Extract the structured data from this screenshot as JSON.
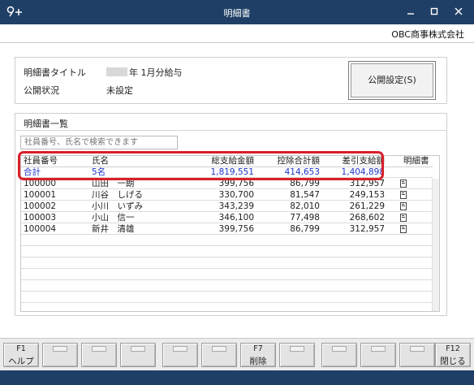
{
  "window": {
    "title": "明細書",
    "icons": {
      "app": "key-plus-icon",
      "minimize": "minimize-icon",
      "maximize": "maximize-icon",
      "close": "close-icon"
    }
  },
  "header": {
    "company": "OBC商事株式会社"
  },
  "info": {
    "title_label": "明細書タイトル",
    "title_value": "年 1月分給与",
    "status_label": "公開状況",
    "status_value": "未設定",
    "publish_button": "公開設定(S)"
  },
  "list": {
    "title": "明細書一覧",
    "search_placeholder": "社員番号、氏名で検索できます",
    "columns": {
      "emp_no": "社員番号",
      "name": "氏名",
      "gross": "総支給金額",
      "deduction": "控除合計額",
      "net": "差引支給額",
      "doc": "明細書"
    },
    "total": {
      "label": "合計",
      "count": "5名",
      "gross": "1,819,551",
      "deduction": "414,653",
      "net": "1,404,898"
    },
    "rows": [
      {
        "emp_no": "100000",
        "name": "山田　一朗",
        "gross": "399,756",
        "deduction": "86,799",
        "net": "312,957"
      },
      {
        "emp_no": "100001",
        "name": "川谷　しげる",
        "gross": "330,700",
        "deduction": "81,547",
        "net": "249,153"
      },
      {
        "emp_no": "100002",
        "name": "小川　いずみ",
        "gross": "343,239",
        "deduction": "82,010",
        "net": "261,229"
      },
      {
        "emp_no": "100003",
        "name": "小山　信一",
        "gross": "346,100",
        "deduction": "77,498",
        "net": "268,602"
      },
      {
        "emp_no": "100004",
        "name": "新井　清雄",
        "gross": "399,756",
        "deduction": "86,799",
        "net": "312,957"
      }
    ],
    "doc_icon": "document-icon"
  },
  "footer": {
    "f1_num": "F1",
    "f1_label": "ヘルプ",
    "f7_num": "F7",
    "f7_label": "削除",
    "f12_num": "F12",
    "f12_label": "閉じる"
  },
  "colors": {
    "titlebar": "#1f3f66",
    "total_text": "#1f35c8",
    "highlight": "#d81f2a"
  }
}
